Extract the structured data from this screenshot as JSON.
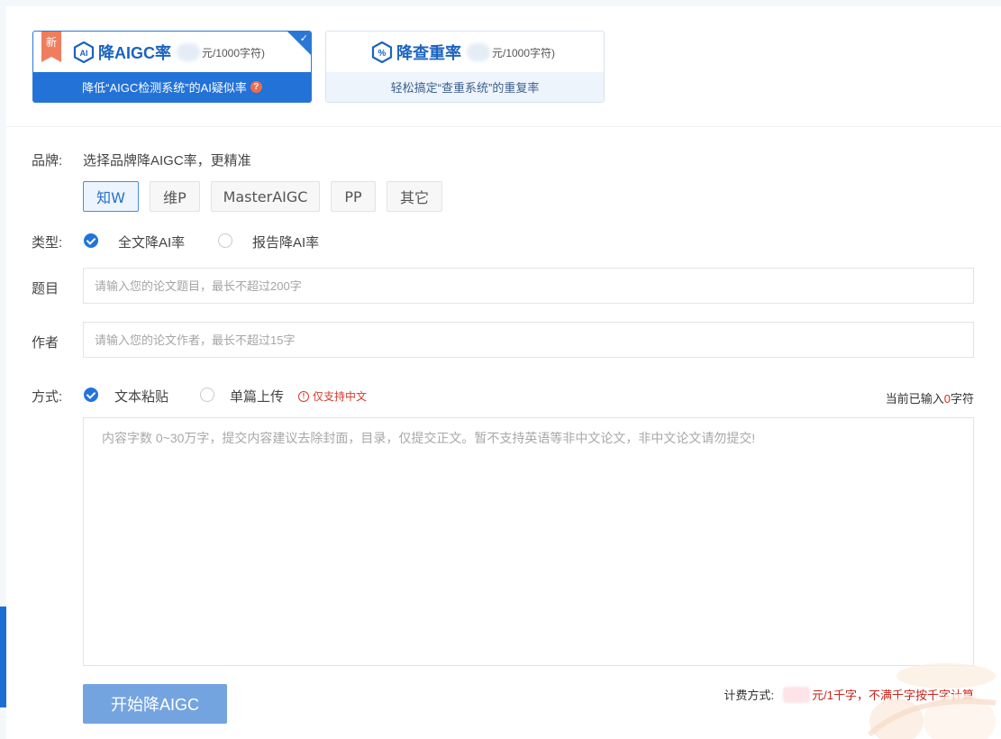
{
  "modes": {
    "aigc": {
      "badge": "新",
      "title": "降AIGC率",
      "price_suffix": "元/1000字符)",
      "subtitle": "降低“AIGC检测系统”的AI疑似率",
      "help_icon": "?"
    },
    "duplicate": {
      "title": "降查重率",
      "price_suffix": "元/1000字符)",
      "subtitle": "轻松搞定“查重系统”的重复率"
    }
  },
  "brand": {
    "label": "品牌:",
    "hint": "选择品牌降AIGC率，更精准",
    "options": [
      "知W",
      "维P",
      "MasterAIGC",
      "PP",
      "其它"
    ],
    "selected": "知W"
  },
  "type": {
    "label": "类型:",
    "options": [
      "全文降AI率",
      "报告降AI率"
    ],
    "selected": "全文降AI率"
  },
  "title_field": {
    "label": "题目",
    "placeholder": "请输入您的论文题目，最长不超过200字"
  },
  "author_field": {
    "label": "作者",
    "placeholder": "请输入您的论文作者，最长不超过15字"
  },
  "method": {
    "label": "方式:",
    "options": [
      "文本粘贴",
      "单篇上传"
    ],
    "selected": "文本粘贴",
    "warning": "仅支持中文",
    "counter_prefix": "当前已输入",
    "counter_value": "0",
    "counter_suffix": "字符"
  },
  "content": {
    "placeholder": "内容字数 0~30万字，提交内容建议去除封面，目录，仅提交正文。暂不支持英语等非中文论文，非中文论文请勿提交!"
  },
  "submit_label": "开始降AIGC",
  "billing": {
    "label": "计费方式:",
    "rule": "元/1千字，不满千字按千字计算"
  },
  "colors": {
    "primary": "#2272d8",
    "danger": "#d53a2e",
    "button_disabled": "#74a4e0"
  }
}
